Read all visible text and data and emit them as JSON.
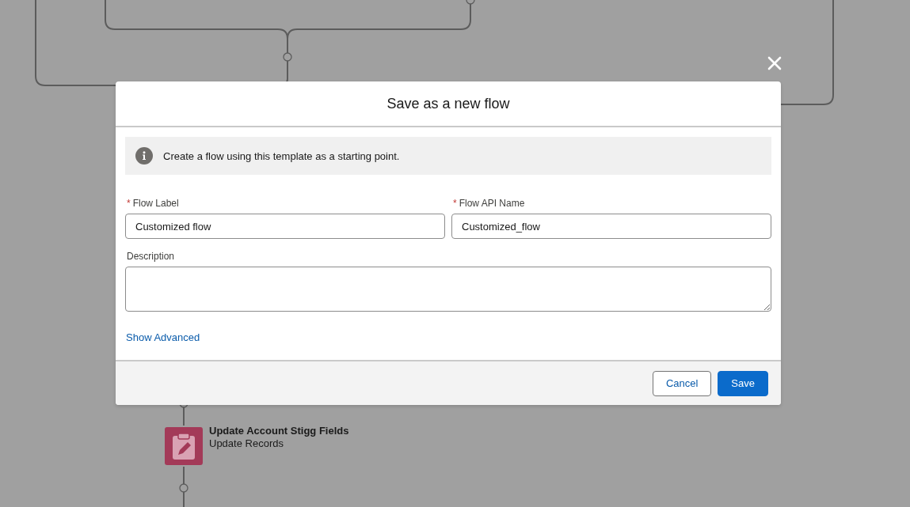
{
  "canvas": {
    "element": {
      "title": "Update Account Stigg Fields",
      "subtitle": "Update Records"
    }
  },
  "dialog": {
    "title": "Save as a new flow",
    "info": "Create a flow using this template as a starting point.",
    "fields": [
      {
        "kind": "input",
        "required_mark": "*",
        "label": "Flow Label",
        "value": "Customized flow"
      },
      {
        "kind": "input",
        "required_mark": "*",
        "label": "Flow API Name",
        "value": "Customized_flow"
      },
      {
        "kind": "textarea",
        "label": "Description"
      }
    ],
    "link": "Show Advanced",
    "buttons": [
      {
        "label": "Cancel",
        "kind": "neutral"
      },
      {
        "label": "Save",
        "kind": "brand"
      }
    ]
  }
}
